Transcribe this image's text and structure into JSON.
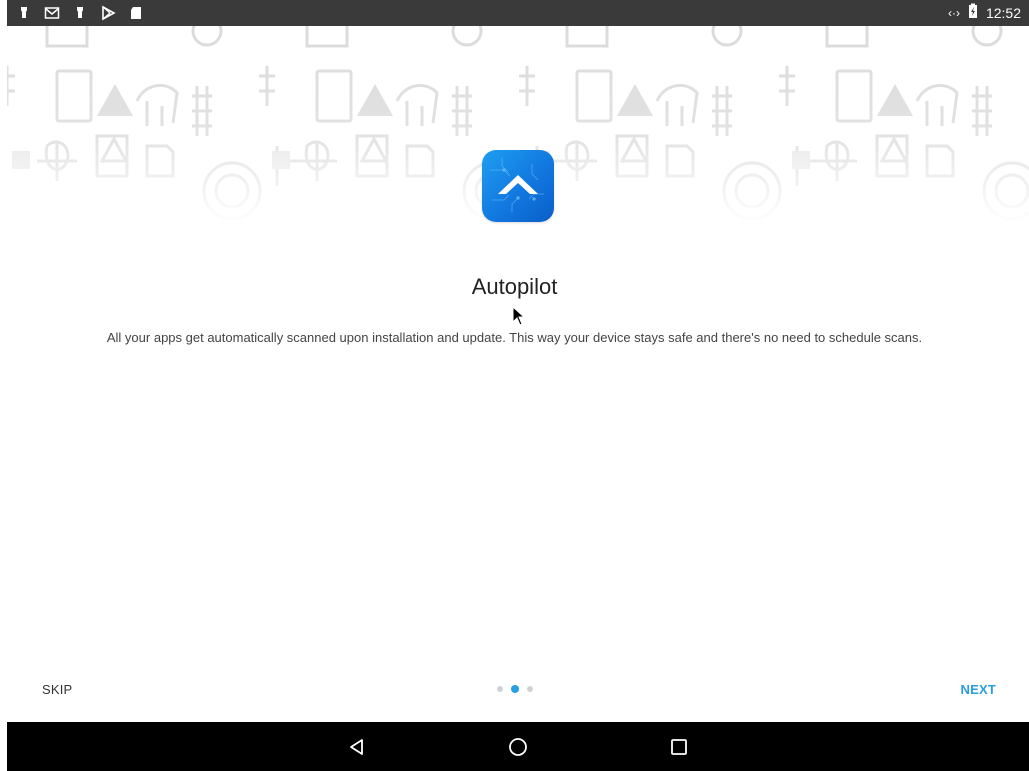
{
  "status_bar": {
    "time": "12:52",
    "left_icons": [
      "notification-icon",
      "gmail-icon",
      "notification-icon",
      "play-store-icon",
      "sd-card-icon"
    ],
    "right_icons": [
      "data-transfer-icon",
      "battery-charging-icon"
    ]
  },
  "onboarding": {
    "title": "Autopilot",
    "description": "All your apps get automatically scanned upon installation and update. This way your device stays safe and there's no need to schedule scans.",
    "app_icon": "autopilot-icon",
    "page_indicator": {
      "total": 3,
      "current": 2
    }
  },
  "footer": {
    "skip_label": "SKIP",
    "next_label": "NEXT"
  },
  "nav_bar": {
    "buttons": [
      "back-icon",
      "home-icon",
      "recents-icon"
    ]
  },
  "colors": {
    "accent": "#2a9fe0",
    "status_bar": "#3a3a3a",
    "nav_bar": "#000000"
  }
}
